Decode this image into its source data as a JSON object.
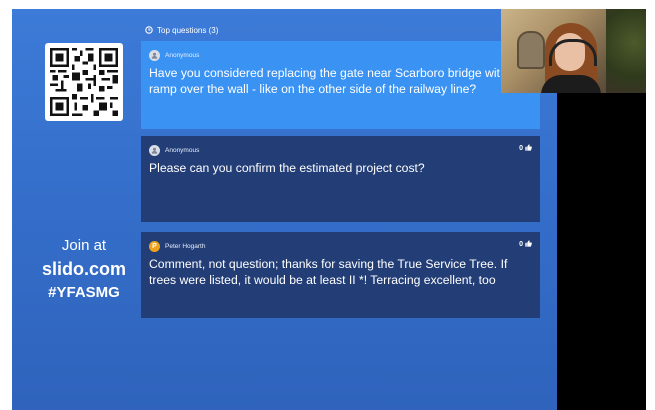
{
  "join": {
    "line1": "Join at",
    "url": "slido.com",
    "code": "#YFASMG"
  },
  "header": {
    "label": "Top questions (3)"
  },
  "questions": [
    {
      "author": "Anonymous",
      "text": "Have you considered replacing the gate near Scarboro bridge with a ramp over the wall - like on the other side of the railway line?",
      "line1": "Have you considered replacing the gate near Scarboro bridge wit",
      "line2": "ramp over the wall - like on the other side of the railway line?",
      "likes": "",
      "highlighted": true
    },
    {
      "author": "Anonymous",
      "text": "Please can you confirm the estimated project cost?",
      "likes": "0"
    },
    {
      "author": "Peter Hogarth",
      "avatar_initial": "P",
      "text": "Comment, not question; thanks for saving the True Service Tree. If trees were listed, it would be at least II *! Terracing excellent, too",
      "likes": "0"
    }
  ],
  "colors": {
    "background": "#3570cc",
    "highlight_card": "#3a93f3",
    "card": "#233e76",
    "avatar_user": "#f1a21c"
  },
  "icons": {
    "header": "clock-icon",
    "like": "thumbs-up-icon",
    "anonymous_avatar": "anonymous-user-icon"
  }
}
